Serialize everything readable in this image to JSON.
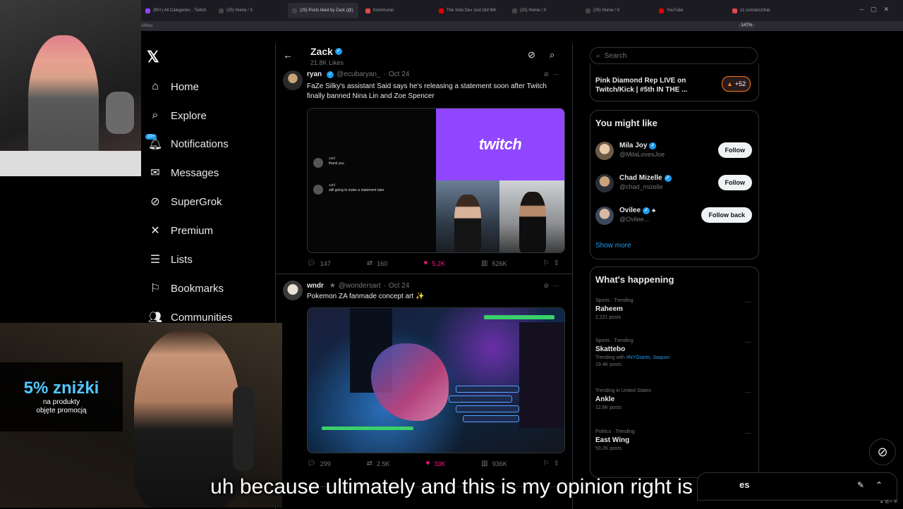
{
  "browser": {
    "tabs": [
      {
        "label": "(90+) All Categories · Twitch",
        "color": "#9146ff",
        "active": false
      },
      {
        "label": "(25) Home / X",
        "color": "#444444",
        "active": false
      },
      {
        "label": "(25) Posts liked by Zack (@)",
        "color": "#444444",
        "active": true
      },
      {
        "label": "Kommunal",
        "color": "#e24a4a",
        "active": false
      },
      {
        "label": "The Solo Dev Just Did Wh",
        "color": "#e00000",
        "active": false
      },
      {
        "label": "(25) Home / X",
        "color": "#444444",
        "active": false
      },
      {
        "label": "(25) Home / X",
        "color": "#444444",
        "active": false
      },
      {
        "label": "YouTube",
        "color": "#e00000",
        "active": false
      },
      {
        "label": "x1.com/arc/chat",
        "color": "#e24a4a",
        "active": false
      }
    ],
    "url_text": "/i/likes",
    "zoom": "147%"
  },
  "sidebar": {
    "notification_count": "20+",
    "items": [
      {
        "label": "Home",
        "icon": "home-icon"
      },
      {
        "label": "Explore",
        "icon": "search-icon"
      },
      {
        "label": "Notifications",
        "icon": "bell-icon"
      },
      {
        "label": "Messages",
        "icon": "mail-icon"
      },
      {
        "label": "SuperGrok",
        "icon": "grok-icon"
      },
      {
        "label": "Premium",
        "icon": "x-premium-icon"
      },
      {
        "label": "Lists",
        "icon": "list-icon"
      },
      {
        "label": "Bookmarks",
        "icon": "bookmark-icon"
      },
      {
        "label": "Communities",
        "icon": "communities-icon"
      }
    ]
  },
  "profile_header": {
    "name": "Zack",
    "likes_count": "21.8K Likes"
  },
  "tweets": [
    {
      "name": "ryan",
      "handle": "@ecubaryan_",
      "date": "Oct 24",
      "text": "FaZe Silky's assistant Said says he's releasing a statement soon after Twitch finally banned Nina Lin and Zoe Spencer",
      "media": {
        "brand": "twitch",
        "chat": [
          {
            "user": "said",
            "text": "thank you"
          },
          {
            "user": "said",
            "text": "still going to make a statement later"
          }
        ]
      },
      "replies": "147",
      "reposts": "160",
      "likes": "5.2K",
      "views": "526K"
    },
    {
      "name": "wndr",
      "handle": "@wondersart",
      "date": "Oct 24",
      "text": "Pokemon ZA fanmade concept art ✨",
      "replies": "299",
      "reposts": "2.5K",
      "likes": "33K",
      "views": "936K"
    }
  ],
  "right": {
    "search_placeholder": "Search",
    "promo_text": "Pink Diamond Rep LIVE on Twitch/Kick | #5th IN THE ...",
    "promo_badge": "+52",
    "you_might_like": {
      "title": "You might like",
      "users": [
        {
          "name": "Mila Joy",
          "handle": "@MilaLovesJoe",
          "button": "Follow"
        },
        {
          "name": "Chad Mizelle",
          "handle": "@chad_mizelle",
          "button": "Follow"
        },
        {
          "name": "Ovilee",
          "handle": "@Ovilee...",
          "button": "Follow back"
        }
      ],
      "show_more": "Show more"
    },
    "whats_happening": {
      "title": "What's happening",
      "trends": [
        {
          "context": "Sports · Trending",
          "topic": "Raheem",
          "sub": "2,221 posts",
          "tags": ""
        },
        {
          "context": "Sports · Trending",
          "topic": "Skattebo",
          "sub_prefix": "Trending with",
          "tags": "#NYGiants, Saquon",
          "sub": "19.4K posts"
        },
        {
          "context": "Trending in United States",
          "topic": "Ankle",
          "sub": "12.8K posts",
          "tags": ""
        },
        {
          "context": "Politics · Trending",
          "topic": "East Wing",
          "sub": "53.2K posts",
          "tags": ""
        }
      ]
    }
  },
  "overlay": {
    "promo_big": "5% zniżki",
    "promo_small_1": "na produkty",
    "promo_small_2": "objęte promocją",
    "caption": "uh because ultimately and this is my opinion right is",
    "messages_suffix": "es"
  },
  "colors": {
    "accent": "#1d9bf0",
    "like": "#f91880",
    "twitch": "#9146ff"
  }
}
